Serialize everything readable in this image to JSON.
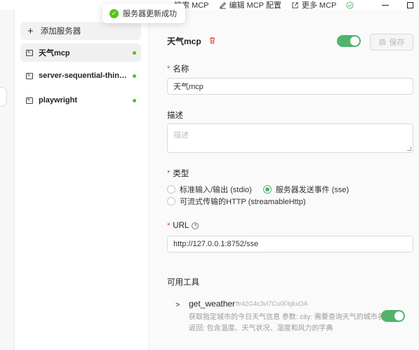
{
  "toolbar": {
    "search_mcp": "搜索 MCP",
    "edit_config": "编辑 MCP 配置",
    "more_mcp": "更多 MCP"
  },
  "toast": {
    "message": "服务器更新成功"
  },
  "sidebar": {
    "add_server": "添加服务器",
    "servers": [
      {
        "name": "天气mcp",
        "status": "active"
      },
      {
        "name": "server-sequential-thinking",
        "status": "active"
      },
      {
        "name": "playwright",
        "status": "active"
      }
    ]
  },
  "detail": {
    "title": "天气mcp",
    "enabled": true,
    "save_label": "保存",
    "name_label": "名称",
    "name_value": "天气mcp",
    "desc_label": "描述",
    "desc_placeholder": "描述",
    "type_label": "类型",
    "type_options": [
      {
        "label": "标准输入/输出 (stdio)",
        "selected": false
      },
      {
        "label": "服务器发送事件 (sse)",
        "selected": true
      },
      {
        "label": "可流式传输的HTTP (streamableHttp)",
        "selected": false
      }
    ],
    "url_label": "URL",
    "url_value": "http://127.0.0.1:8752/sse",
    "tools_label": "可用工具",
    "tools": [
      {
        "name": "get_weather",
        "id": "ftr42G4c3vI7Cu0FbjkxOA",
        "description": "获取指定城市的今日天气信息 参数: city: 需要查询天气的城市名称 返回: 包含温度、天气状况、湿度和风力的字典",
        "enabled": true
      }
    ]
  },
  "colors": {
    "accent": "#52b36c",
    "required": "#e0453a",
    "status_dot": "#52c41a"
  }
}
